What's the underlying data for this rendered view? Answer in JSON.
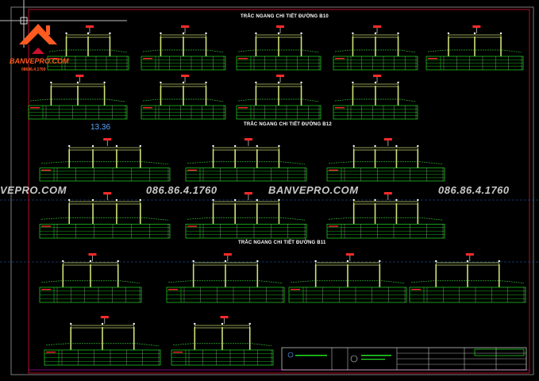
{
  "logo": {
    "name": "BANVEPRO.COM",
    "phone": "08686.4.1760"
  },
  "section_titles": [
    "TRẮC NGANG CHI TIẾT ĐƯỜNG B10",
    "TRẮC NGANG CHI TIẾT ĐƯỜNG B12",
    "TRẮC NGANG CHI TIẾT ĐƯỜNG B11"
  ],
  "dimension_label": "13.36",
  "watermark": {
    "left_site": "VEPRO.COM",
    "phone_1": "086.86.4.1760",
    "site_2": "BANVEPRO.COM",
    "phone_2": "086.86.4.1760"
  },
  "colors": {
    "background": "#000000",
    "frame": "#b0b0b0",
    "border_red": "#c8102e",
    "border_magenta": "#b000b0",
    "road": "#cfe07a",
    "ground": "#2fb52f",
    "table": "#20e020",
    "accent": "#ff2a2a"
  }
}
